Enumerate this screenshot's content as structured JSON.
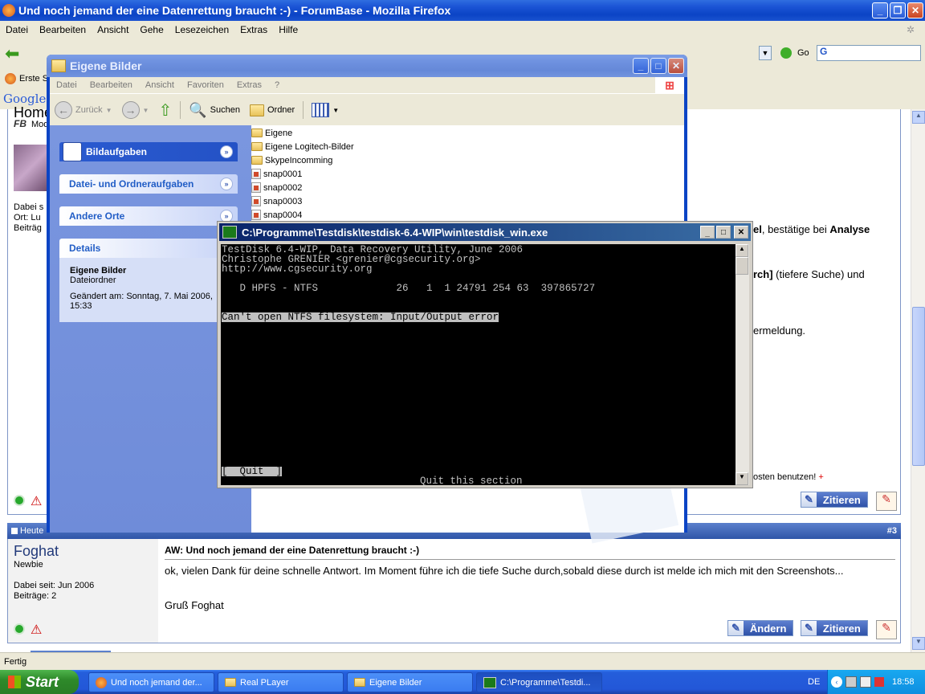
{
  "firefox": {
    "title": "Und noch jemand der eine Datenrettung braucht :-) - ForumBase - Mozilla Firefox",
    "menu": [
      "Datei",
      "Bearbeiten",
      "Ansicht",
      "Gehe",
      "Lesezeichen",
      "Extras",
      "Hilfe"
    ],
    "url_text": "",
    "go_label": "Go",
    "bookmark_label": "Erste S",
    "google_label": "Google",
    "status": "Fertig"
  },
  "forum": {
    "partial_header": "Home",
    "mod_label": "Mod",
    "user1_lines": [
      "Dabei s",
      "Ort: Lu",
      "Beiträg"
    ],
    "visible_text_1_pre": "el",
    "visible_text_1_post": ", bestätige bei ",
    "visible_text_1_bold": "Analyse",
    "visible_text_2_bold": "rch]",
    "visible_text_2_rest": " (tiefere Suche) und",
    "visible_text_3": "ermeldung.",
    "visible_text_4": "osten benutzen!",
    "visible_text_4_plus": "+",
    "zitieren": "Zitieren",
    "aendern": "Ändern",
    "post3_header_date": "Heute",
    "post3_number": "#3",
    "post3_user": "Foghat",
    "post3_rank": "Newbie",
    "post3_joined": "Dabei seit: Jun 2006",
    "post3_posts": "Beiträge: 2",
    "post3_title": "AW: Und noch jemand der eine Datenrettung braucht :-)",
    "post3_body": "ok, vielen Dank für deine schnelle Antwort. Im Moment führe ich die tiefe Suche durch,sobald diese durch ist melde ich mich mit den Screenshots...",
    "post3_sign": "Gruß Foghat"
  },
  "explorer": {
    "title": "Eigene Bilder",
    "menu": [
      "Datei",
      "Bearbeiten",
      "Ansicht",
      "Favoriten",
      "Extras",
      "?"
    ],
    "back_label": "Zurück",
    "search_label": "Suchen",
    "folder_label": "Ordner",
    "tasks": [
      "Bildaufgaben",
      "Datei- und Ordneraufgaben",
      "Andere Orte"
    ],
    "details_head": "Details",
    "details_name": "Eigene Bilder",
    "details_type": "Dateiordner",
    "details_changed": "Geändert am: Sonntag, 7. Mai 2006, 15:33",
    "files": [
      {
        "name": "Eigene",
        "icon": "folder-icon"
      },
      {
        "name": "Eigene Logitech-Bilder",
        "icon": "folder-icon"
      },
      {
        "name": "SkypeIncomming",
        "icon": "folder-icon"
      },
      {
        "name": "snap0001",
        "icon": "image-file-icon"
      },
      {
        "name": "snap0002",
        "icon": "image-file-icon"
      },
      {
        "name": "snap0003",
        "icon": "image-file-icon"
      },
      {
        "name": "snap0004",
        "icon": "image-file-icon"
      }
    ]
  },
  "console": {
    "title": "C:\\Programme\\Testdisk\\testdisk-6.4-WIP\\win\\testdisk_win.exe",
    "line1": "TestDisk 6.4-WIP, Data Recovery Utility, June 2006",
    "line2": "Christophe GRENIER <grenier@cgsecurity.org>",
    "line3": "http://www.cgsecurity.org",
    "partition_line": "   D HPFS - NTFS             26   1  1 24791 254 63  397865727",
    "error_line": "Can't open NTFS filesystem: Input/Output error",
    "quit_button": "[  Quit  ]",
    "quit_hint": "Quit this section"
  },
  "taskbar": {
    "start": "Start",
    "items": [
      "Und noch jemand der...",
      "Real PLayer",
      "Eigene Bilder",
      "C:\\Programme\\Testdi..."
    ],
    "lang": "DE",
    "clock": "18:58"
  },
  "colors": {
    "xp_blue": "#0b44c5",
    "explorer_pane": "#7a96df",
    "console_bg": "#000000",
    "forum_header": "#3a5fb0"
  }
}
